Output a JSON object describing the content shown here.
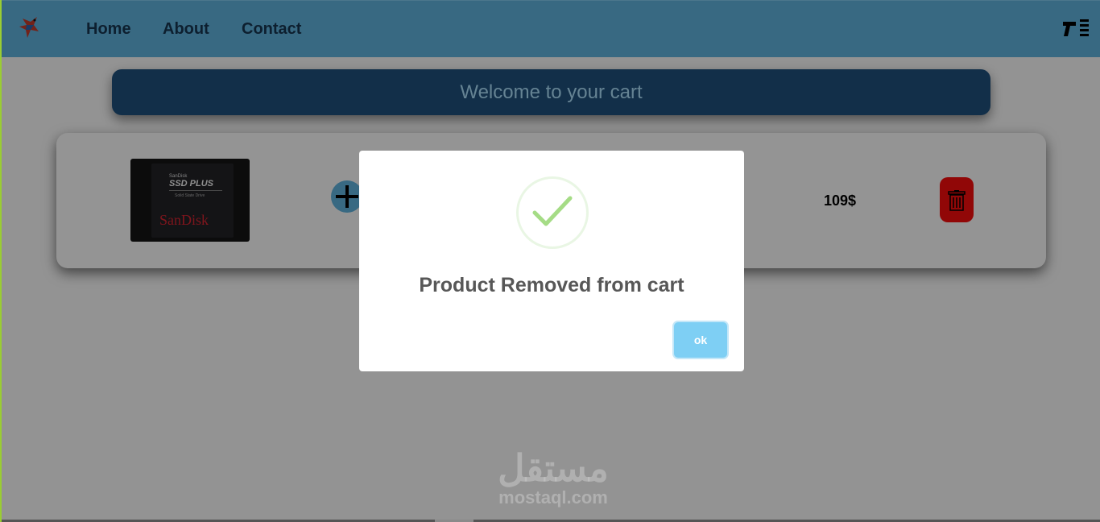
{
  "navbar": {
    "links": [
      "Home",
      "About",
      "Contact"
    ],
    "logo_icon": "parrot-logo-icon",
    "menu_icon": "sidebar-menu-icon"
  },
  "cart": {
    "welcome_text": "Welcome to your cart",
    "item": {
      "image_brand": "SanDisk",
      "image_model": "SSD PLUS",
      "image_sub": "Solid State Drive",
      "price": "109$",
      "add_icon": "plus-icon",
      "delete_icon": "trash-icon"
    }
  },
  "modal": {
    "icon": "check-icon",
    "title": "Product Removed from cart",
    "ok_label": "ok"
  },
  "watermark": {
    "arabic": "مستقل",
    "latin": "mostaql.com"
  },
  "colors": {
    "navbar": "#5eb0d9",
    "nav_text": "#17344f",
    "welcome_bg": "#1f4f7a",
    "welcome_text": "#a9daf5",
    "delete": "#f20d0d",
    "ok_button": "#7ecff4",
    "success": "#a5dc86"
  }
}
